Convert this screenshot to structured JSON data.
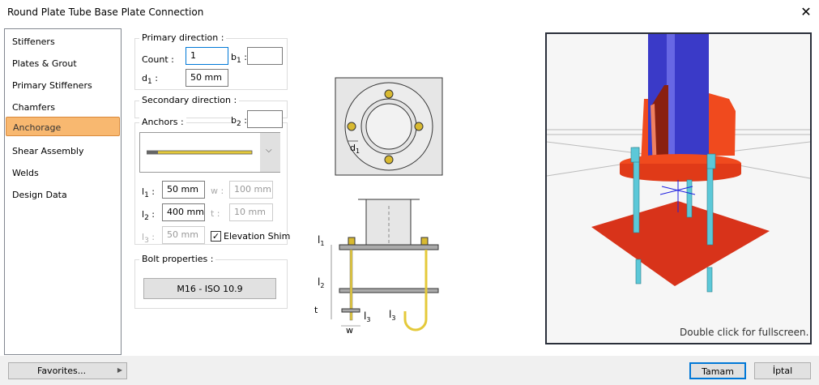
{
  "window": {
    "title": "Round Plate Tube Base Plate Connection",
    "close_icon": "close-icon"
  },
  "sidebar": {
    "items": [
      {
        "label": "Stiffeners",
        "selected": false
      },
      {
        "label": "Plates & Grout",
        "selected": false
      },
      {
        "label": "Primary Stiffeners",
        "selected": false
      },
      {
        "label": "Chamfers",
        "selected": false
      },
      {
        "label": "Anchorage",
        "selected": true
      },
      {
        "label": "Shear Assembly",
        "selected": false
      },
      {
        "label": "Welds",
        "selected": false
      },
      {
        "label": "Design Data",
        "selected": false
      }
    ],
    "selected_color": "#f8b870"
  },
  "primary": {
    "title": "Primary direction :",
    "count_label": "Count :",
    "count_value": "1",
    "b1_label": "b",
    "b1_sub": "1",
    "b1_value": "",
    "d1_label": "d",
    "d1_sub": "1",
    "d1_value": "50 mm"
  },
  "secondary": {
    "title": "Secondary direction :",
    "b2_label": "b",
    "b2_sub": "2",
    "b2_value": ""
  },
  "anchors": {
    "title": "Anchors :",
    "selected_type": "straight-anchor-rod",
    "l1_label": "l",
    "l1_sub": "1",
    "l1_value": "50 mm",
    "l2_label": "l",
    "l2_sub": "2",
    "l2_value": "400 mm",
    "l3_label": "l",
    "l3_sub": "3",
    "l3_value": "50 mm",
    "w_label": "w :",
    "w_value": "100 mm",
    "t_label": "t :",
    "t_value": "10 mm",
    "elevation_shim_label": "Elevation Shim",
    "elevation_shim_checked": true
  },
  "bolt": {
    "title": "Bolt properties :",
    "button": "M16 - ISO 10.9"
  },
  "diagram": {
    "d1": "d",
    "d1_sub": "1",
    "l1": "l",
    "l1_sub": "1",
    "l2": "l",
    "l2_sub": "2",
    "t": "t",
    "l3": "l",
    "l3_sub": "3",
    "w": "w"
  },
  "view3d": {
    "hint": "Double click for fullscreen.",
    "column_color": "#3a3ac8",
    "plate_color": "#e8401c",
    "bolt_color": "#5cc8d8"
  },
  "footer": {
    "favorites": "Favorites...",
    "ok": "Tamam",
    "cancel": "İptal"
  }
}
